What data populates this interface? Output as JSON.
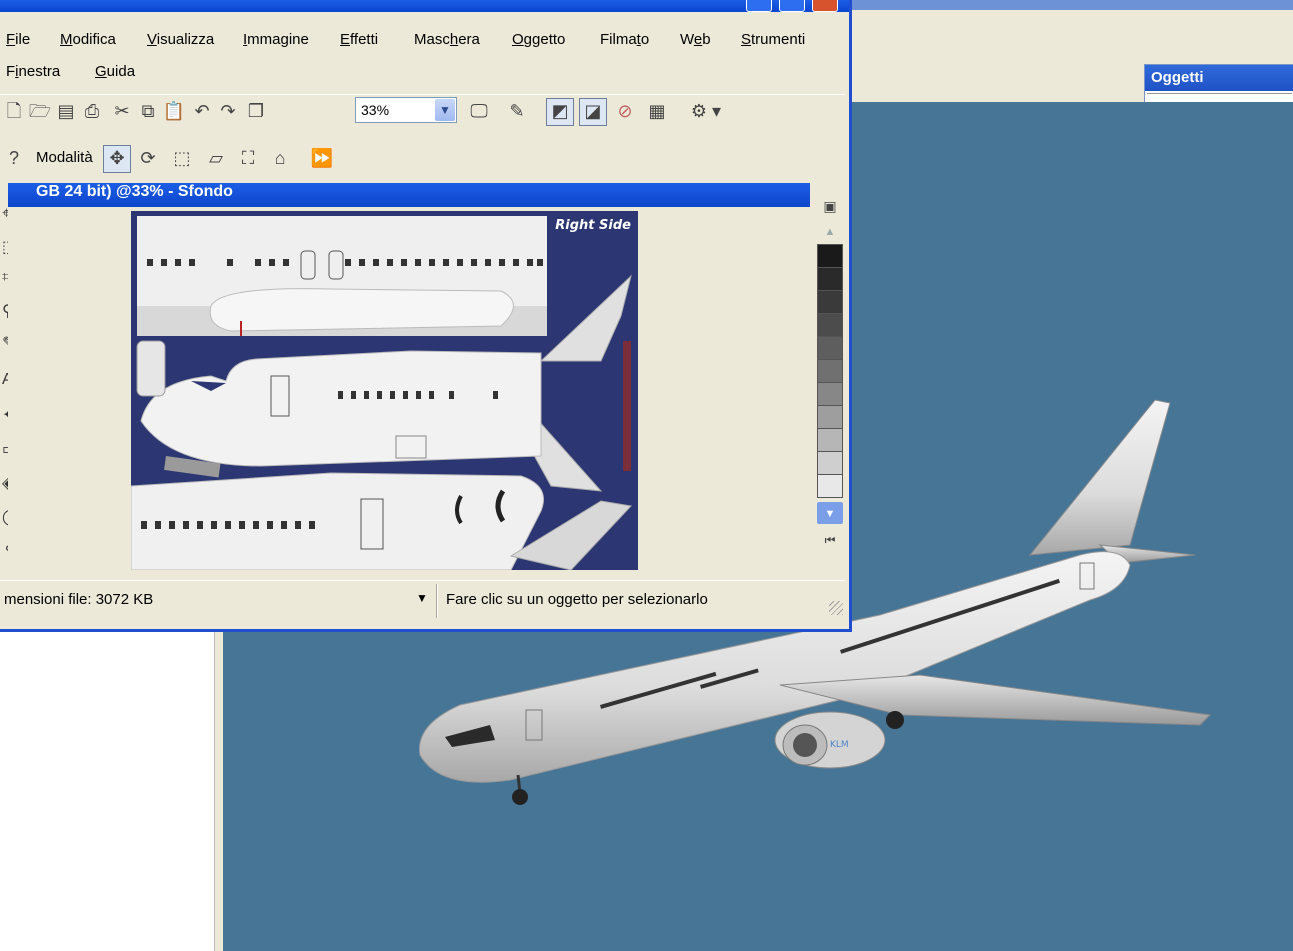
{
  "viewer": {
    "objects_panel_title": "Oggetti"
  },
  "paint": {
    "menu": [
      {
        "label": "File",
        "underline_index": 0
      },
      {
        "label": "Modifica",
        "underline_index": 0
      },
      {
        "label": "Visualizza",
        "underline_index": 0
      },
      {
        "label": "Immagine",
        "underline_index": 0
      },
      {
        "label": "Effetti",
        "underline_index": 0
      },
      {
        "label": "Maschera",
        "underline_index": 4
      },
      {
        "label": "Oggetto",
        "underline_index": 0
      },
      {
        "label": "Filmato",
        "underline_index": 5
      },
      {
        "label": "Web",
        "underline_index": 1
      },
      {
        "label": "Strumenti",
        "underline_index": 0
      },
      {
        "label": "Finestra",
        "underline_index": 1
      },
      {
        "label": "Guida",
        "underline_index": 0
      }
    ],
    "zoom_value": "33%",
    "mode_label": "Modalità",
    "document_title": "GB 24 bit) @33% - Sfondo",
    "texture_label": "Right Side",
    "status_left": "mensioni file: 3072 KB",
    "status_right": "Fare clic su un oggetto per selezionarlo",
    "palette_colors": [
      "#1a1a1a",
      "#2a2a2a",
      "#3a3a3a",
      "#4c4c4c",
      "#5e5e5e",
      "#707070",
      "#878787",
      "#9e9e9e",
      "#b6b6b6",
      "#cfcfcf",
      "#e8e8e8"
    ]
  },
  "colors": {
    "viewport_bg": "#467596",
    "xp_blue": "#1f4fd0",
    "window_face": "#ece9d8"
  }
}
